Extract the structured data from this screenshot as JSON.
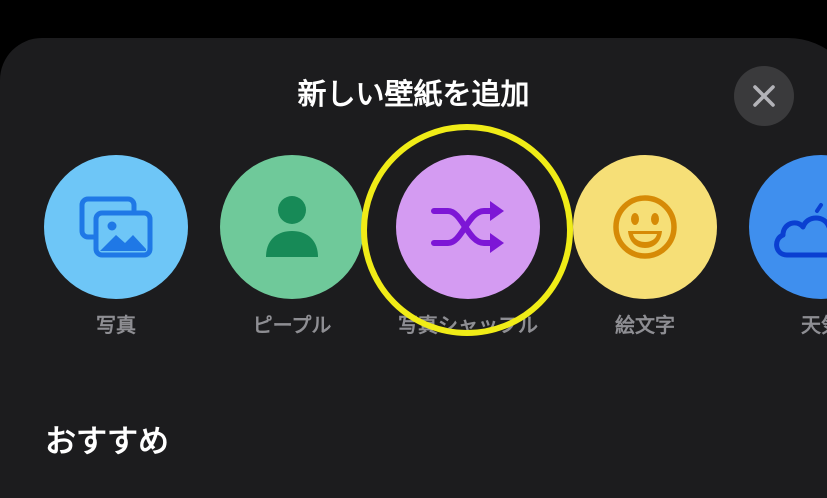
{
  "header": {
    "title": "新しい壁紙を追加"
  },
  "close": {
    "icon": "close-icon",
    "label": "×"
  },
  "wallpaper_types": [
    {
      "label": "写真",
      "icon": "photos-icon",
      "color": "#6ec6f7",
      "icon_color": "#1f78e6"
    },
    {
      "label": "ピープル",
      "icon": "person-icon",
      "color": "#6fc99a",
      "icon_color": "#178a57"
    },
    {
      "label": "写真シャッフル",
      "icon": "shuffle-icon",
      "color": "#d49bf2",
      "icon_color": "#7d16d6",
      "highlighted": true
    },
    {
      "label": "絵文字",
      "icon": "emoji-smile-icon",
      "color": "#f6df77",
      "icon_color": "#d68a06"
    },
    {
      "label": "天気",
      "icon": "weather-icon",
      "color": "#3f8fee",
      "icon_color": "#0a3fd1"
    }
  ],
  "section": {
    "title": "おすすめ"
  },
  "colors": {
    "background": "#000000",
    "sheet": "#1c1c1e",
    "highlight": "#f0ec17",
    "label": "#8e8e93"
  }
}
